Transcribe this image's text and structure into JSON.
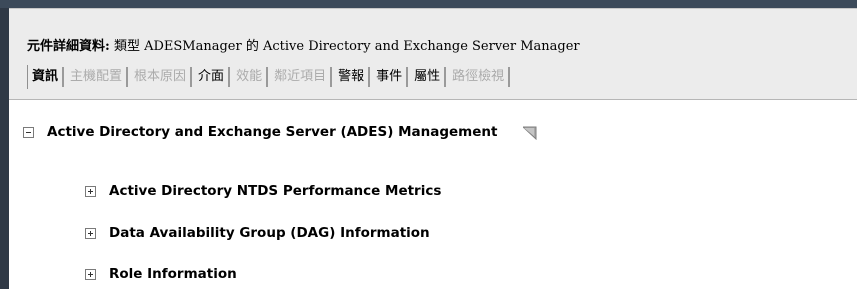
{
  "header": {
    "title_prefix": "元件詳細資料:",
    "title_rest": "類型 ADESManager 的 Active Directory and Exchange Server Manager"
  },
  "tabs": [
    {
      "label": "資訊",
      "state": "active"
    },
    {
      "label": "主機配置",
      "state": "disabled"
    },
    {
      "label": "根本原因",
      "state": "disabled"
    },
    {
      "label": "介面",
      "state": "enabled"
    },
    {
      "label": "效能",
      "state": "disabled"
    },
    {
      "label": "鄰近項目",
      "state": "disabled"
    },
    {
      "label": "警報",
      "state": "enabled"
    },
    {
      "label": "事件",
      "state": "enabled"
    },
    {
      "label": "屬性",
      "state": "enabled"
    },
    {
      "label": "路徑檢視",
      "state": "disabled"
    }
  ],
  "tree": {
    "root": {
      "label": "Active Directory and Exchange Server (ADES) Management",
      "expanded": true,
      "icon": "flag-icon"
    },
    "children": [
      {
        "label": "Active Directory NTDS Performance Metrics",
        "expanded": false
      },
      {
        "label": "Data Availability Group (DAG) Information",
        "expanded": false
      },
      {
        "label": "Role Information",
        "expanded": false
      }
    ]
  },
  "colors": {
    "tab_disabled": "#ababab",
    "header_bg": "#ececec",
    "frame": "#2f3946"
  }
}
